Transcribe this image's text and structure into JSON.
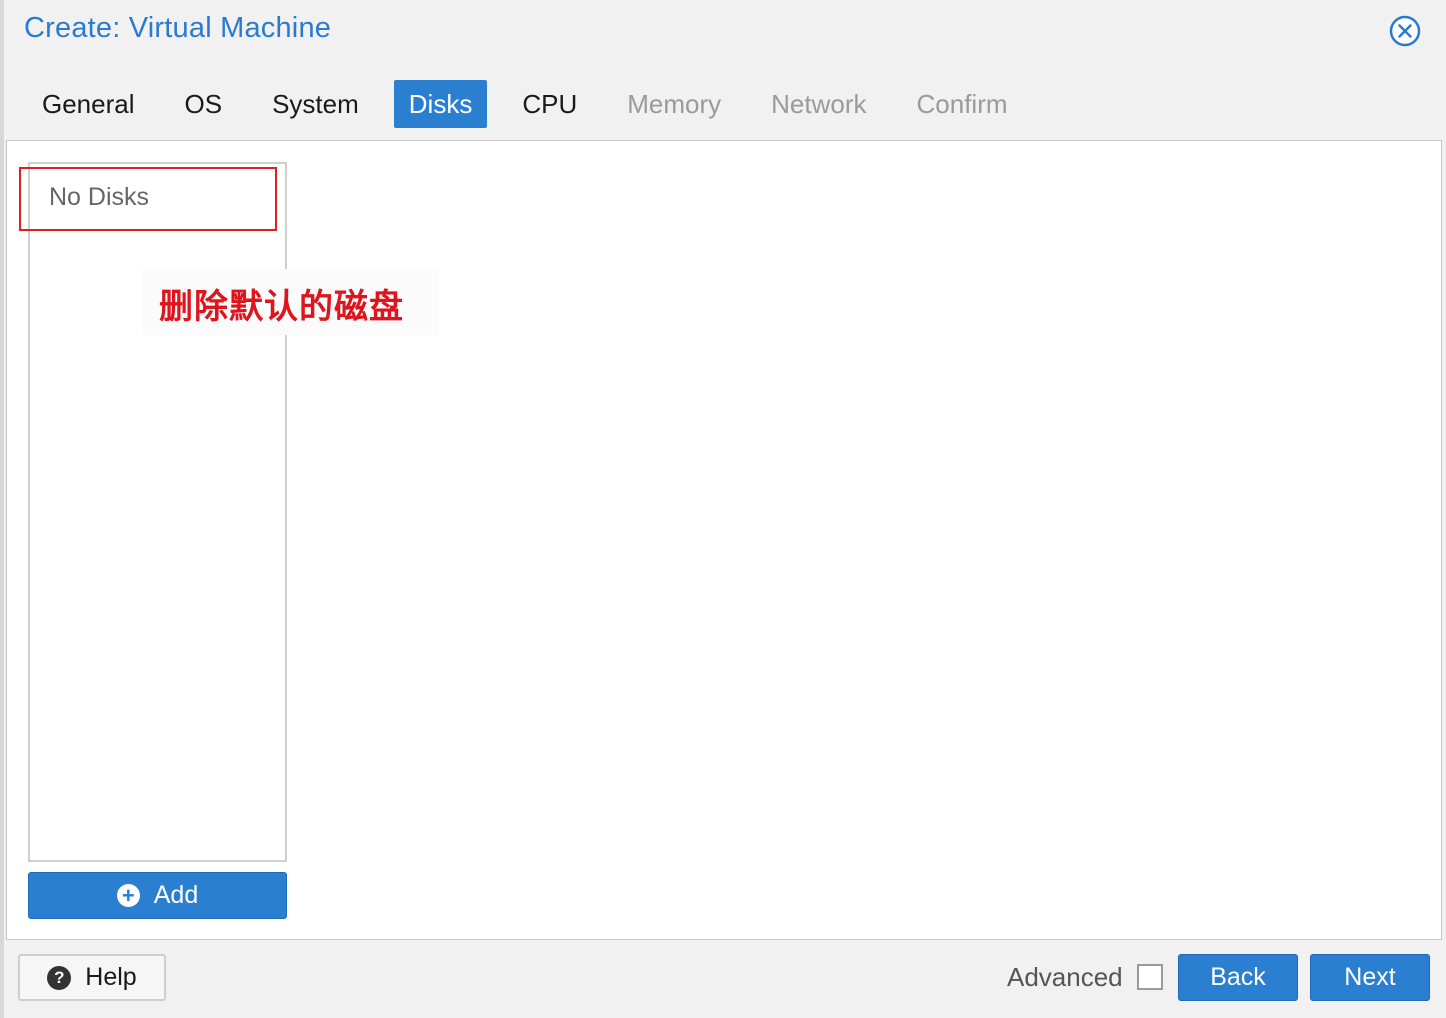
{
  "dialog": {
    "title": "Create: Virtual Machine"
  },
  "tabs": [
    {
      "label": "General",
      "state": "enabled"
    },
    {
      "label": "OS",
      "state": "enabled"
    },
    {
      "label": "System",
      "state": "enabled"
    },
    {
      "label": "Disks",
      "state": "active"
    },
    {
      "label": "CPU",
      "state": "enabled"
    },
    {
      "label": "Memory",
      "state": "disabled"
    },
    {
      "label": "Network",
      "state": "disabled"
    },
    {
      "label": "Confirm",
      "state": "disabled"
    }
  ],
  "disks": {
    "empty_text": "No Disks",
    "add_label": "Add"
  },
  "annotation": {
    "text": "删除默认的磁盘",
    "color": "#e0141c"
  },
  "footer": {
    "help_label": "Help",
    "advanced_label": "Advanced",
    "advanced_checked": false,
    "back_label": "Back",
    "next_label": "Next"
  },
  "colors": {
    "accent": "#2b7fd0",
    "title": "#2a7bd0",
    "disabled_tab": "#9a9a9a"
  },
  "icons": {
    "close": "close-circle-icon",
    "add": "plus-circle-icon",
    "help": "question-circle-icon"
  }
}
